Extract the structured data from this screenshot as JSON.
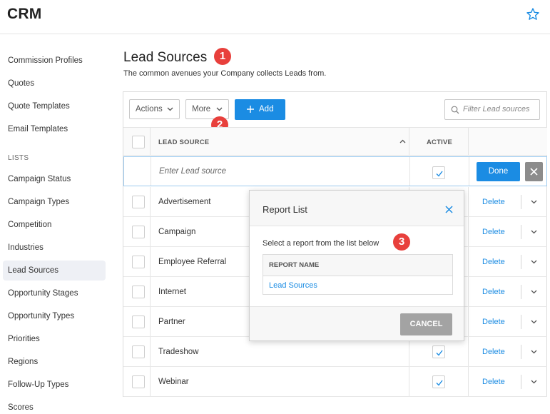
{
  "app": {
    "title": "CRM",
    "favorite_icon": "star-outline-icon",
    "accent_color": "#1b8ce3",
    "badge_color": "#e8403c"
  },
  "sidebar": {
    "items_top": [
      "Commission Profiles",
      "Quotes",
      "Quote Templates",
      "Email Templates"
    ],
    "section_label": "LISTS",
    "items_lists": [
      "Campaign Status",
      "Campaign Types",
      "Competition",
      "Industries",
      "Lead Sources",
      "Opportunity Stages",
      "Opportunity Types",
      "Priorities",
      "Regions",
      "Follow-Up Types",
      "Scores"
    ],
    "active": "Lead Sources"
  },
  "page": {
    "title": "Lead Sources",
    "subtitle": "The common avenues your Company collects Leads from."
  },
  "badges": [
    "1",
    "2",
    "3"
  ],
  "toolbar": {
    "actions_label": "Actions",
    "more_label": "More",
    "add_label": "Add",
    "filter_placeholder": "Filter Lead sources"
  },
  "table": {
    "col_source": "LEAD SOURCE",
    "col_active": "ACTIVE",
    "new_row_placeholder": "Enter Lead source",
    "new_row_active": true,
    "done_label": "Done",
    "delete_label": "Delete",
    "rows": [
      {
        "name": "Advertisement",
        "active": false
      },
      {
        "name": "Campaign",
        "active": false
      },
      {
        "name": "Employee Referral",
        "active": false
      },
      {
        "name": "Internet",
        "active": false
      },
      {
        "name": "Partner",
        "active": false
      },
      {
        "name": "Tradeshow",
        "active": true
      },
      {
        "name": "Webinar",
        "active": true
      }
    ]
  },
  "modal": {
    "title": "Report List",
    "instruction": "Select a report from the list below",
    "column_header": "REPORT NAME",
    "reports": [
      "Lead Sources"
    ],
    "cancel_label": "CANCEL"
  }
}
